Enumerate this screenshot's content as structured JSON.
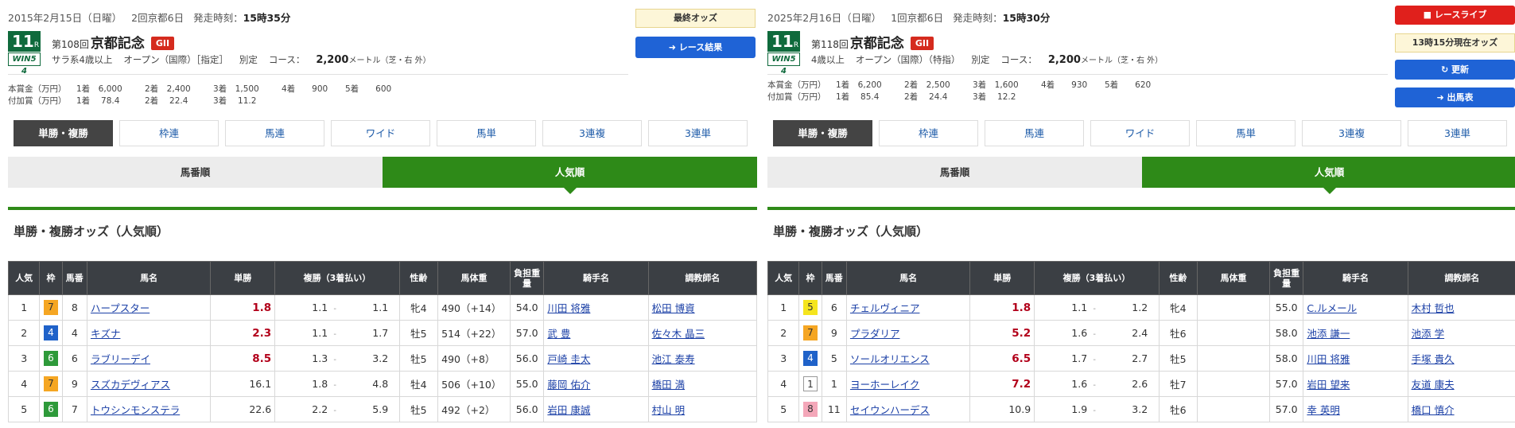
{
  "colors": {
    "green": "#2e8a18",
    "race_box": "#0f6a3c",
    "grade": "#d52b1e",
    "blue_button": "#1f63d6",
    "red_button": "#e0201c",
    "odds_value": "#b2001a",
    "table_header": "#3b3f44"
  },
  "left": {
    "date": "2015年2月15日（日曜）",
    "kaisai": "2回京都6日",
    "start_label": "発走時刻：",
    "start_time": "15時35分",
    "race_no": "11",
    "race_unit": "R",
    "g_badge": "WIN5 4",
    "kai": "第108回",
    "name": "京都記念",
    "grade": "GII",
    "cond": {
      "age": "サラ系4歳以上",
      "cls": "オープン（国際）［指定］",
      "weight": "別定",
      "course_label": "コース：",
      "dist": "2,200",
      "unit": "メートル（芝・右 外）"
    },
    "prize_label": "本賞金（万円）",
    "prize": [
      "1着　6,000",
      "2着　2,400",
      "3着　1,500",
      "4着　　900",
      "5着　　600"
    ],
    "add_label": "付加賞（万円）",
    "add": [
      "1着　 78.4",
      "2着　 22.4",
      "3着　 11.2"
    ],
    "btn_odds": "最終オッズ",
    "btn_result": "➜ レース結果"
  },
  "right": {
    "date": "2025年2月16日（日曜）",
    "kaisai": "1回京都6日",
    "start_label": "発走時刻：",
    "start_time": "15時30分",
    "race_no": "11",
    "race_unit": "R",
    "g_badge": "WIN5 4",
    "kai": "第118回",
    "name": "京都記念",
    "grade": "GII",
    "cond": {
      "age": "4歳以上",
      "cls": "オープン（国際）（特指）",
      "weight": "別定",
      "course_label": "コース：",
      "dist": "2,200",
      "unit": "メートル（芝・右 外）"
    },
    "prize_label": "本賞金（万円）",
    "prize": [
      "1着　6,200",
      "2着　2,500",
      "3着　1,600",
      "4着　　930",
      "5着　　620"
    ],
    "add_label": "付加賞（万円）",
    "add": [
      "1着　 85.4",
      "2着　 24.4",
      "3着　 12.2"
    ],
    "btn_live": "■ レースライブ",
    "btn_time": "13時15分現在オッズ",
    "btn_update": "↻ 更新",
    "btn_card": "➜ 出馬表"
  },
  "tabs": [
    "単勝・複勝",
    "枠連",
    "馬連",
    "ワイド",
    "馬単",
    "3連複",
    "3連単"
  ],
  "sort": {
    "off": "馬番順",
    "on": "人気順"
  },
  "section_title": "単勝・複勝オッズ（人気順）",
  "columns": [
    "人気",
    "枠",
    "馬番",
    "馬名",
    "単勝",
    "複勝（3着払い）",
    "性齢",
    "馬体重",
    "負担重量",
    "騎手名",
    "調教師名"
  ],
  "rows_left": [
    {
      "pop": "1",
      "waku": "7",
      "num": "8",
      "name": "ハープスター",
      "win": "1.8",
      "win_hot": true,
      "plo": "1.1",
      "phi": "1.1",
      "sex": "牝4",
      "wt": "490（+14）",
      "load": "54.0",
      "jockey": "川田 将雅",
      "trainer": "松田 博資"
    },
    {
      "pop": "2",
      "waku": "4",
      "num": "4",
      "name": "キズナ",
      "win": "2.3",
      "win_hot": true,
      "plo": "1.1",
      "phi": "1.7",
      "sex": "牡5",
      "wt": "514（+22）",
      "load": "57.0",
      "jockey": "武 豊",
      "trainer": "佐々木 晶三"
    },
    {
      "pop": "3",
      "waku": "6",
      "num": "6",
      "name": "ラブリーデイ",
      "win": "8.5",
      "win_hot": true,
      "plo": "1.3",
      "phi": "3.2",
      "sex": "牡5",
      "wt": "490（+8）",
      "load": "56.0",
      "jockey": "戸崎 圭太",
      "trainer": "池江 泰寿"
    },
    {
      "pop": "4",
      "waku": "7",
      "num": "9",
      "name": "スズカデヴィアス",
      "win": "16.1",
      "win_hot": false,
      "plo": "1.8",
      "phi": "4.8",
      "sex": "牡4",
      "wt": "506（+10）",
      "load": "55.0",
      "jockey": "藤岡 佑介",
      "trainer": "橋田 満"
    },
    {
      "pop": "5",
      "waku": "6",
      "num": "7",
      "name": "トウシンモンステラ",
      "win": "22.6",
      "win_hot": false,
      "plo": "2.2",
      "phi": "5.9",
      "sex": "牡5",
      "wt": "492（+2）",
      "load": "56.0",
      "jockey": "岩田 康誠",
      "trainer": "村山 明"
    }
  ],
  "rows_right": [
    {
      "pop": "1",
      "waku": "5",
      "num": "6",
      "name": "チェルヴィニア",
      "win": "1.8",
      "win_hot": true,
      "plo": "1.1",
      "phi": "1.2",
      "sex": "牝4",
      "wt": "",
      "load": "55.0",
      "jockey": "C.ルメール",
      "trainer": "木村 哲也"
    },
    {
      "pop": "2",
      "waku": "7",
      "num": "9",
      "name": "プラダリア",
      "win": "5.2",
      "win_hot": true,
      "plo": "1.6",
      "phi": "2.4",
      "sex": "牡6",
      "wt": "",
      "load": "58.0",
      "jockey": "池添 謙一",
      "trainer": "池添 学"
    },
    {
      "pop": "3",
      "waku": "4",
      "num": "5",
      "name": "ソールオリエンス",
      "win": "6.5",
      "win_hot": true,
      "plo": "1.7",
      "phi": "2.7",
      "sex": "牡5",
      "wt": "",
      "load": "58.0",
      "jockey": "川田 将雅",
      "trainer": "手塚 貴久"
    },
    {
      "pop": "4",
      "waku": "1",
      "num": "1",
      "name": "ヨーホーレイク",
      "win": "7.2",
      "win_hot": true,
      "plo": "1.6",
      "phi": "2.6",
      "sex": "牡7",
      "wt": "",
      "load": "57.0",
      "jockey": "岩田 望来",
      "trainer": "友道 康夫"
    },
    {
      "pop": "5",
      "waku": "8",
      "num": "11",
      "name": "セイウンハーデス",
      "win": "10.9",
      "win_hot": false,
      "plo": "1.9",
      "phi": "3.2",
      "sex": "牡6",
      "wt": "",
      "load": "57.0",
      "jockey": "幸 英明",
      "trainer": "橋口 慎介"
    }
  ],
  "waku_colors": {
    "1": [
      "#ffffff",
      "#333333"
    ],
    "2": [
      "#222222",
      "#ffffff"
    ],
    "3": [
      "#d92a2a",
      "#ffffff"
    ],
    "4": [
      "#1f62c9",
      "#ffffff"
    ],
    "5": [
      "#f5e51e",
      "#333333"
    ],
    "6": [
      "#2e9a3a",
      "#ffffff"
    ],
    "7": [
      "#f5a623",
      "#333333"
    ],
    "8": [
      "#f4a7b9",
      "#333333"
    ]
  }
}
